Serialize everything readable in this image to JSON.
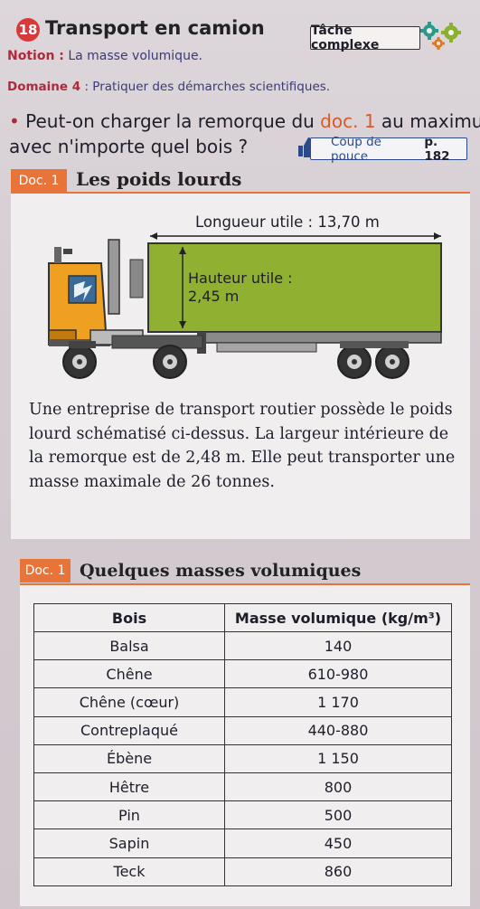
{
  "header": {
    "exercise_number": "18",
    "title": "Transport en camion",
    "task_label": "Tâche complexe",
    "notion_label": "Notion :",
    "notion_value": "La masse volumique.",
    "domaine_label": "Domaine 4",
    "domaine_value": ": Pratiquer des démarches scientifiques.",
    "question_part1": "Peut-on charger la remorque du ",
    "question_doc": "doc. 1",
    "question_part2": " au maximum",
    "question_line2": "avec n'importe quel bois ?",
    "hint_label": "Coup de pouce",
    "hint_page": "p. 182"
  },
  "doc1": {
    "label": "Doc. 1",
    "title": "Les poids lourds",
    "length_label": "Longueur utile : 13,70 m",
    "height_label_line1": "Hauteur utile :",
    "height_label_line2": "2,45 m",
    "text": "Une entreprise de transport routier possède le poids lourd schématisé ci-dessus. La largeur intérieure de la remorque est de 2,48 m. Elle peut transporter une masse maximale de 26 tonnes."
  },
  "doc2": {
    "label": "Doc. 1",
    "title": "Quelques masses volumiques",
    "columns": [
      "Bois",
      "Masse volumique (kg/m³)"
    ],
    "rows": [
      [
        "Balsa",
        "140"
      ],
      [
        "Chêne",
        "610-980"
      ],
      [
        "Chêne (cœur)",
        "1 170"
      ],
      [
        "Contreplaqué",
        "440-880"
      ],
      [
        "Ébène",
        "1 150"
      ],
      [
        "Hêtre",
        "800"
      ],
      [
        "Pin",
        "500"
      ],
      [
        "Sapin",
        "450"
      ],
      [
        "Teck",
        "860"
      ]
    ]
  },
  "colors": {
    "accent": "#e8743a",
    "trailer": "#8fb030",
    "cab": "#f0a020",
    "badge": "#d83a3a"
  }
}
